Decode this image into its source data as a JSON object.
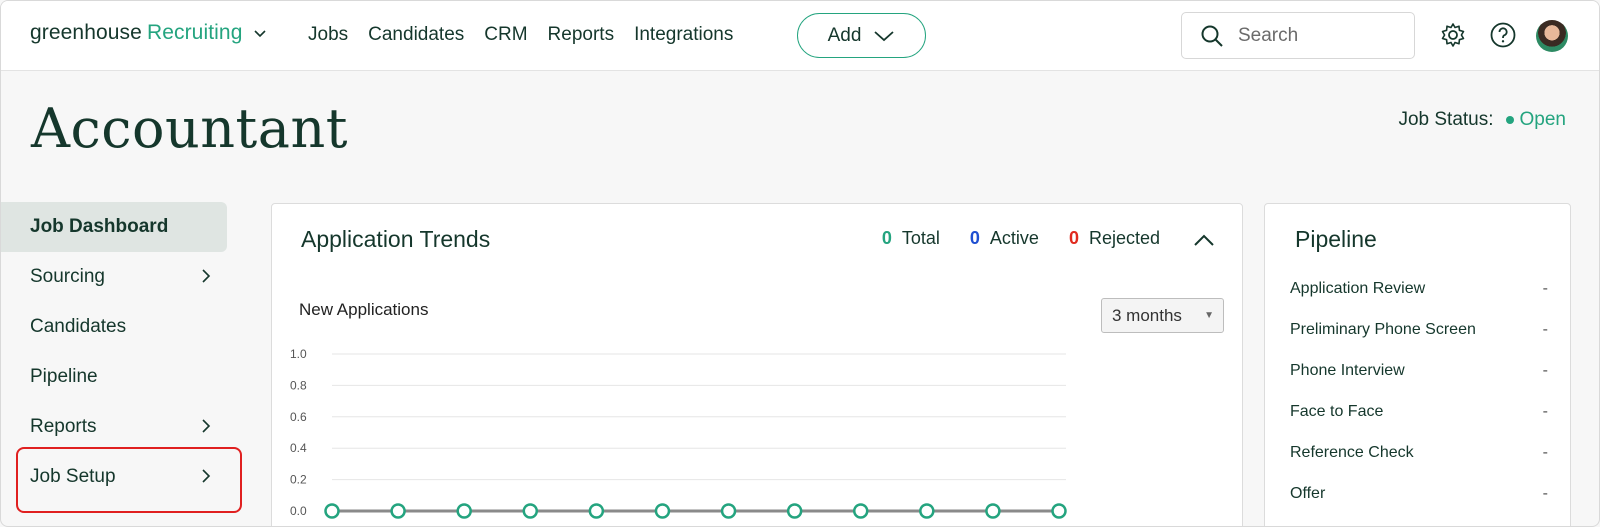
{
  "brand": {
    "name": "greenhouse",
    "product": "Recruiting"
  },
  "nav": {
    "links": [
      "Jobs",
      "Candidates",
      "CRM",
      "Reports",
      "Integrations"
    ],
    "add_label": "Add",
    "search_placeholder": "Search"
  },
  "page": {
    "title": "Accountant",
    "job_status_label": "Job Status:",
    "job_status_value": "Open"
  },
  "sidebar": {
    "items": [
      {
        "label": "Job Dashboard",
        "active": true,
        "has_chevron": false
      },
      {
        "label": "Sourcing",
        "active": false,
        "has_chevron": true
      },
      {
        "label": "Candidates",
        "active": false,
        "has_chevron": false
      },
      {
        "label": "Pipeline",
        "active": false,
        "has_chevron": false
      },
      {
        "label": "Reports",
        "active": false,
        "has_chevron": true
      },
      {
        "label": "Job Setup",
        "active": false,
        "has_chevron": true
      }
    ]
  },
  "trends": {
    "title": "Application Trends",
    "stats": [
      {
        "value": "0",
        "label": "Total"
      },
      {
        "value": "0",
        "label": "Active"
      },
      {
        "value": "0",
        "label": "Rejected"
      }
    ],
    "subtitle": "New Applications",
    "range_selected": "3 months"
  },
  "chart_data": {
    "type": "line",
    "title": "New Applications",
    "xlabel": "",
    "ylabel": "",
    "ylim": [
      0,
      1.0
    ],
    "y_ticks": [
      "1.0",
      "0.8",
      "0.6",
      "0.4",
      "0.2",
      "0.0"
    ],
    "x": [
      1,
      2,
      3,
      4,
      5,
      6,
      7,
      8,
      9,
      10,
      11,
      12
    ],
    "series": [
      {
        "values": [
          0,
          0,
          0,
          0,
          0,
          0,
          0,
          0,
          0,
          0,
          0,
          0
        ]
      }
    ],
    "grid": true
  },
  "pipeline": {
    "title": "Pipeline",
    "stages": [
      {
        "name": "Application Review",
        "value": "-"
      },
      {
        "name": "Preliminary Phone Screen",
        "value": "-"
      },
      {
        "name": "Phone Interview",
        "value": "-"
      },
      {
        "name": "Face to Face",
        "value": "-"
      },
      {
        "name": "Reference Check",
        "value": "-"
      },
      {
        "name": "Offer",
        "value": "-"
      }
    ]
  },
  "colors": {
    "brand_green": "#24a47f",
    "dark_green": "#15372c",
    "active_blue": "#1f4fd1",
    "rejected_red": "#e02a1e",
    "highlight_red": "#e02020"
  }
}
